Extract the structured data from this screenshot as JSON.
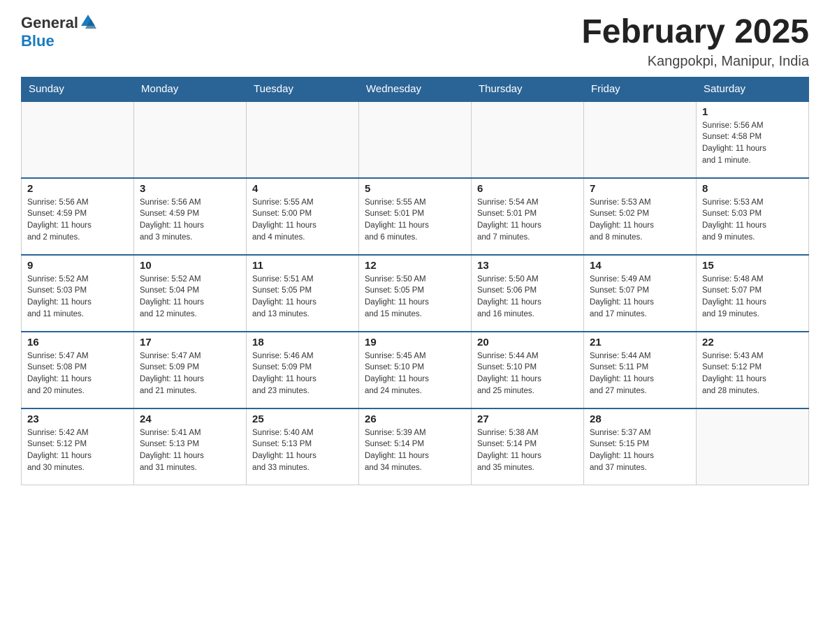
{
  "header": {
    "logo_general": "General",
    "logo_blue": "Blue",
    "title": "February 2025",
    "subtitle": "Kangpokpi, Manipur, India"
  },
  "weekdays": [
    "Sunday",
    "Monday",
    "Tuesday",
    "Wednesday",
    "Thursday",
    "Friday",
    "Saturday"
  ],
  "weeks": [
    [
      {
        "day": "",
        "info": ""
      },
      {
        "day": "",
        "info": ""
      },
      {
        "day": "",
        "info": ""
      },
      {
        "day": "",
        "info": ""
      },
      {
        "day": "",
        "info": ""
      },
      {
        "day": "",
        "info": ""
      },
      {
        "day": "1",
        "info": "Sunrise: 5:56 AM\nSunset: 4:58 PM\nDaylight: 11 hours\nand 1 minute."
      }
    ],
    [
      {
        "day": "2",
        "info": "Sunrise: 5:56 AM\nSunset: 4:59 PM\nDaylight: 11 hours\nand 2 minutes."
      },
      {
        "day": "3",
        "info": "Sunrise: 5:56 AM\nSunset: 4:59 PM\nDaylight: 11 hours\nand 3 minutes."
      },
      {
        "day": "4",
        "info": "Sunrise: 5:55 AM\nSunset: 5:00 PM\nDaylight: 11 hours\nand 4 minutes."
      },
      {
        "day": "5",
        "info": "Sunrise: 5:55 AM\nSunset: 5:01 PM\nDaylight: 11 hours\nand 6 minutes."
      },
      {
        "day": "6",
        "info": "Sunrise: 5:54 AM\nSunset: 5:01 PM\nDaylight: 11 hours\nand 7 minutes."
      },
      {
        "day": "7",
        "info": "Sunrise: 5:53 AM\nSunset: 5:02 PM\nDaylight: 11 hours\nand 8 minutes."
      },
      {
        "day": "8",
        "info": "Sunrise: 5:53 AM\nSunset: 5:03 PM\nDaylight: 11 hours\nand 9 minutes."
      }
    ],
    [
      {
        "day": "9",
        "info": "Sunrise: 5:52 AM\nSunset: 5:03 PM\nDaylight: 11 hours\nand 11 minutes."
      },
      {
        "day": "10",
        "info": "Sunrise: 5:52 AM\nSunset: 5:04 PM\nDaylight: 11 hours\nand 12 minutes."
      },
      {
        "day": "11",
        "info": "Sunrise: 5:51 AM\nSunset: 5:05 PM\nDaylight: 11 hours\nand 13 minutes."
      },
      {
        "day": "12",
        "info": "Sunrise: 5:50 AM\nSunset: 5:05 PM\nDaylight: 11 hours\nand 15 minutes."
      },
      {
        "day": "13",
        "info": "Sunrise: 5:50 AM\nSunset: 5:06 PM\nDaylight: 11 hours\nand 16 minutes."
      },
      {
        "day": "14",
        "info": "Sunrise: 5:49 AM\nSunset: 5:07 PM\nDaylight: 11 hours\nand 17 minutes."
      },
      {
        "day": "15",
        "info": "Sunrise: 5:48 AM\nSunset: 5:07 PM\nDaylight: 11 hours\nand 19 minutes."
      }
    ],
    [
      {
        "day": "16",
        "info": "Sunrise: 5:47 AM\nSunset: 5:08 PM\nDaylight: 11 hours\nand 20 minutes."
      },
      {
        "day": "17",
        "info": "Sunrise: 5:47 AM\nSunset: 5:09 PM\nDaylight: 11 hours\nand 21 minutes."
      },
      {
        "day": "18",
        "info": "Sunrise: 5:46 AM\nSunset: 5:09 PM\nDaylight: 11 hours\nand 23 minutes."
      },
      {
        "day": "19",
        "info": "Sunrise: 5:45 AM\nSunset: 5:10 PM\nDaylight: 11 hours\nand 24 minutes."
      },
      {
        "day": "20",
        "info": "Sunrise: 5:44 AM\nSunset: 5:10 PM\nDaylight: 11 hours\nand 25 minutes."
      },
      {
        "day": "21",
        "info": "Sunrise: 5:44 AM\nSunset: 5:11 PM\nDaylight: 11 hours\nand 27 minutes."
      },
      {
        "day": "22",
        "info": "Sunrise: 5:43 AM\nSunset: 5:12 PM\nDaylight: 11 hours\nand 28 minutes."
      }
    ],
    [
      {
        "day": "23",
        "info": "Sunrise: 5:42 AM\nSunset: 5:12 PM\nDaylight: 11 hours\nand 30 minutes."
      },
      {
        "day": "24",
        "info": "Sunrise: 5:41 AM\nSunset: 5:13 PM\nDaylight: 11 hours\nand 31 minutes."
      },
      {
        "day": "25",
        "info": "Sunrise: 5:40 AM\nSunset: 5:13 PM\nDaylight: 11 hours\nand 33 minutes."
      },
      {
        "day": "26",
        "info": "Sunrise: 5:39 AM\nSunset: 5:14 PM\nDaylight: 11 hours\nand 34 minutes."
      },
      {
        "day": "27",
        "info": "Sunrise: 5:38 AM\nSunset: 5:14 PM\nDaylight: 11 hours\nand 35 minutes."
      },
      {
        "day": "28",
        "info": "Sunrise: 5:37 AM\nSunset: 5:15 PM\nDaylight: 11 hours\nand 37 minutes."
      },
      {
        "day": "",
        "info": ""
      }
    ]
  ]
}
